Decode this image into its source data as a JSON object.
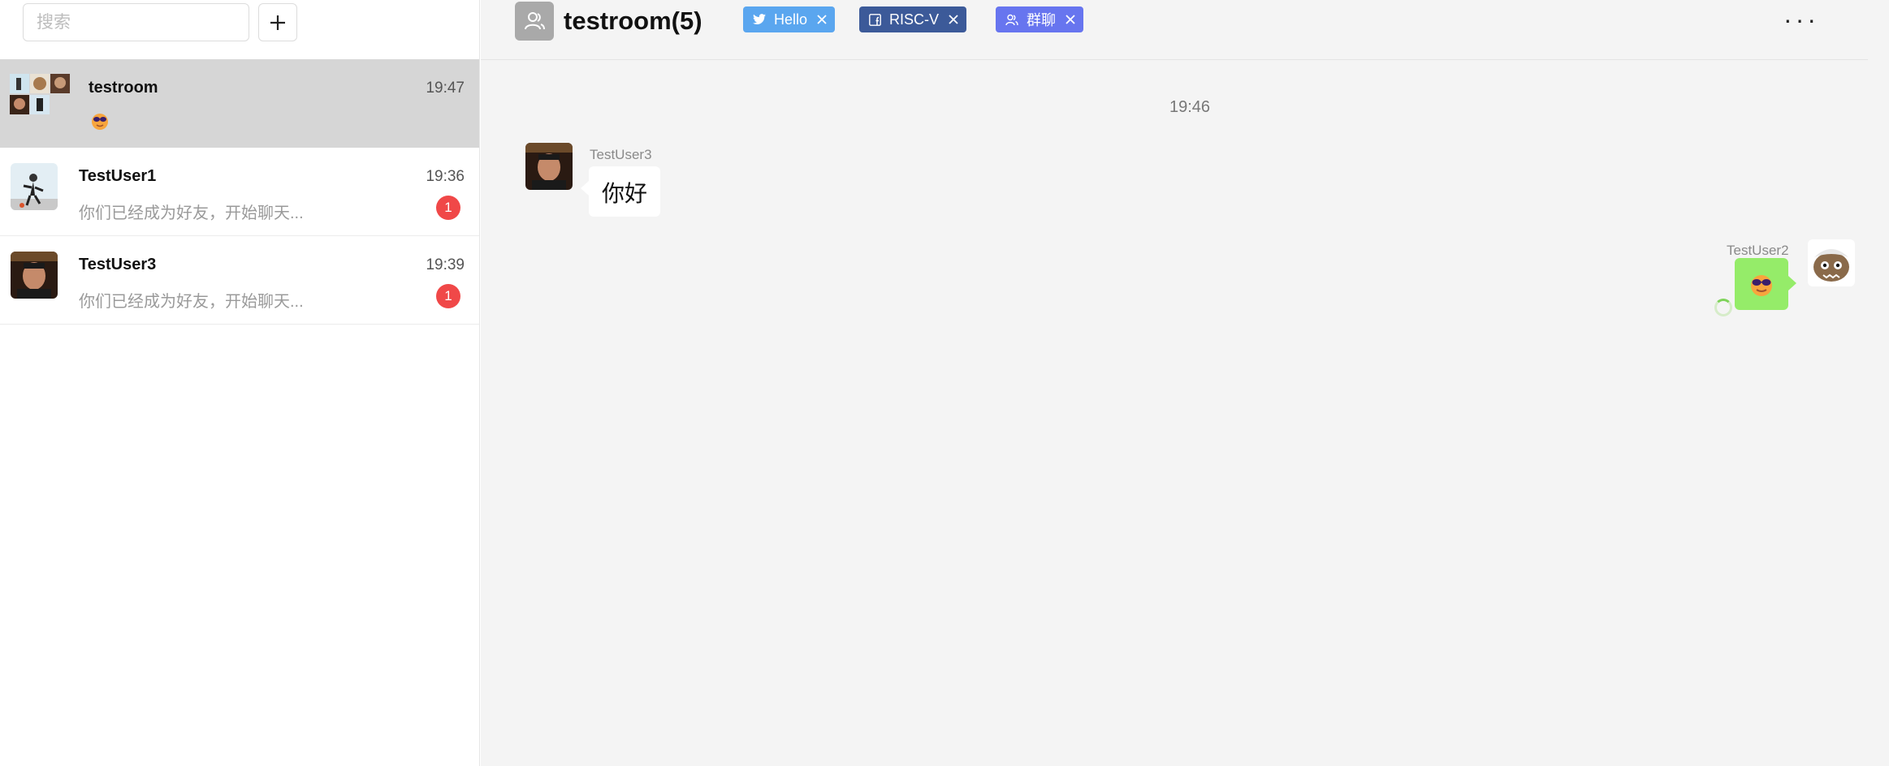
{
  "sidebar": {
    "search_placeholder": "搜索",
    "add_icon": "plus-icon",
    "conversations": [
      {
        "name": "testroom",
        "time": "19:47",
        "preview": "",
        "preview_icon": "sunglasses-emoji",
        "unread": "",
        "active": true
      },
      {
        "name": "TestUser1",
        "time": "19:36",
        "preview": "你们已经成为好友，开始聊天...",
        "unread": "1",
        "active": false
      },
      {
        "name": "TestUser3",
        "time": "19:39",
        "preview": "你们已经成为好友，开始聊天...",
        "unread": "1",
        "active": false
      }
    ]
  },
  "header": {
    "room_icon": "group-icon",
    "title": "testroom(5)",
    "tags": [
      {
        "label": "Hello",
        "icon": "twitter-icon",
        "color": "#5aa6ef"
      },
      {
        "label": "RISC-V",
        "icon": "facebook-icon",
        "color": "#3c5a99"
      },
      {
        "label": "群聊",
        "icon": "group-icon",
        "color": "#6775ef"
      }
    ],
    "more_label": "···"
  },
  "messages": {
    "time_divider": "19:46",
    "items": [
      {
        "sender": "TestUser3",
        "text": "你好",
        "side": "left"
      },
      {
        "sender": "TestUser2",
        "content_icon": "sunglasses-emoji",
        "side": "right",
        "status": "sending"
      }
    ]
  },
  "colors": {
    "active_conversation": "#d6d6d6",
    "unread_badge": "#f04848",
    "self_bubble": "#95ec69",
    "chat_background": "#f4f4f4"
  }
}
